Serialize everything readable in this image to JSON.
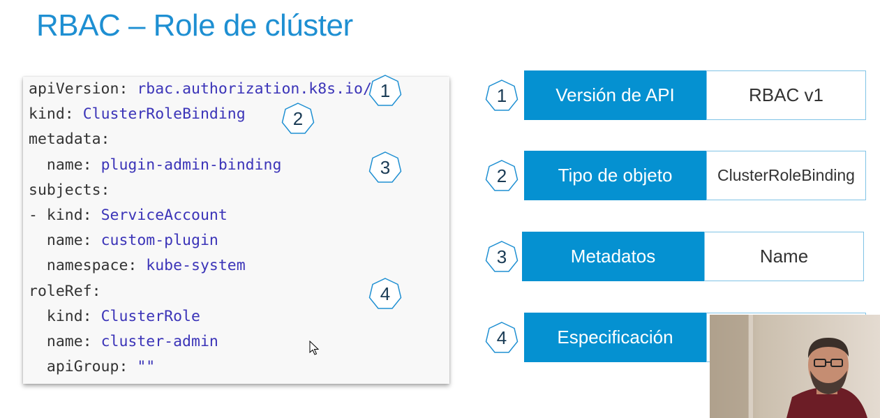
{
  "slide": {
    "title": "RBAC – Role de clúster"
  },
  "yaml_lines": [
    {
      "key": "apiVersion:",
      "value": "rbac.authorization.k8s.io/v1"
    },
    {
      "key": "kind:",
      "value": "ClusterRoleBinding"
    },
    {
      "key": "metadata:",
      "value": ""
    },
    {
      "key": "  name:",
      "value": "plugin-admin-binding"
    },
    {
      "key": "subjects:",
      "value": ""
    },
    {
      "key": "- kind:",
      "value": "ServiceAccount"
    },
    {
      "key": "  name:",
      "value": "custom-plugin"
    },
    {
      "key": "  namespace:",
      "value": "kube-system"
    },
    {
      "key": "roleRef:",
      "value": ""
    },
    {
      "key": "  kind:",
      "value": "ClusterRole"
    },
    {
      "key": "  name:",
      "value": "cluster-admin"
    },
    {
      "key": "  apiGroup:",
      "value": "\"\""
    }
  ],
  "code_markers": [
    "1",
    "2",
    "3",
    "4"
  ],
  "rows": [
    {
      "number": "1",
      "label": "Versión de API",
      "value": "RBAC v1"
    },
    {
      "number": "2",
      "label": "Tipo de objeto",
      "value": "ClusterRoleBinding"
    },
    {
      "number": "3",
      "label": "Metadatos",
      "value": "Name"
    },
    {
      "number": "4",
      "label": "Especificación",
      "value": ""
    }
  ],
  "colors": {
    "accent": "#1e8fd2",
    "label_bg": "#0591d1",
    "code_value": "#3b34b8"
  },
  "icons": {
    "marker": "heptagon-number-icon",
    "cursor": "mouse-pointer-icon"
  }
}
